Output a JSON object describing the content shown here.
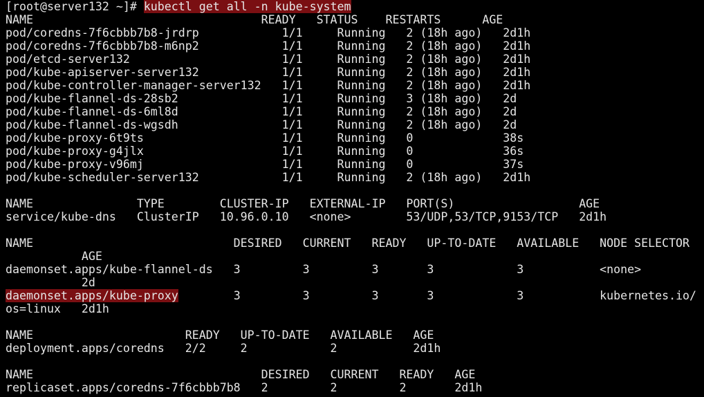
{
  "terminal": {
    "prompt": "[root@server132 ~]# ",
    "command": "kubectl get all -n kube-system",
    "highlight_color": "#7a0f12",
    "background_color": "#000000",
    "text_color": "#e6e6e6",
    "pods": {
      "header": "NAME                                 READY   STATUS    RESTARTS      AGE",
      "rows": [
        "pod/coredns-7f6cbbb7b8-jrdrp            1/1     Running   2 (18h ago)   2d1h",
        "pod/coredns-7f6cbbb7b8-m6np2            1/1     Running   2 (18h ago)   2d1h",
        "pod/etcd-server132                      1/1     Running   2 (18h ago)   2d1h",
        "pod/kube-apiserver-server132            1/1     Running   2 (18h ago)   2d1h",
        "pod/kube-controller-manager-server132   1/1     Running   2 (18h ago)   2d1h",
        "pod/kube-flannel-ds-28sb2               1/1     Running   3 (18h ago)   2d",
        "pod/kube-flannel-ds-6ml8d               1/1     Running   2 (18h ago)   2d",
        "pod/kube-flannel-ds-wgsdh               1/1     Running   2 (18h ago)   2d",
        "pod/kube-proxy-6t9ts                    1/1     Running   0             38s",
        "pod/kube-proxy-g4jlx                    1/1     Running   0             36s",
        "pod/kube-proxy-v96mj                    1/1     Running   0             37s",
        "pod/kube-scheduler-server132            1/1     Running   2 (18h ago)   2d1h"
      ]
    },
    "services": {
      "header": "NAME               TYPE        CLUSTER-IP   EXTERNAL-IP   PORT(S)                  AGE",
      "rows": [
        "service/kube-dns   ClusterIP   10.96.0.10   <none>        53/UDP,53/TCP,9153/TCP   2d1h"
      ]
    },
    "daemonsets": {
      "header": "NAME                             DESIRED   CURRENT   READY   UP-TO-DATE   AVAILABLE   NODE SELECTOR",
      "header_wrap": "           AGE",
      "row1": "daemonset.apps/kube-flannel-ds   3         3         3       3            3           <none>",
      "row1_wrap": "           2d",
      "row2_name": "daemonset.apps/kube-proxy",
      "row2_rest": "        3         3         3       3            3           kubernetes.io/",
      "row2_wrap": "os=linux   2d1h"
    },
    "deployments": {
      "header": "NAME                      READY   UP-TO-DATE   AVAILABLE   AGE",
      "rows": [
        "deployment.apps/coredns   2/2     2            2           2d1h"
      ]
    },
    "replicasets": {
      "header": "NAME                                 DESIRED   CURRENT   READY   AGE",
      "rows": [
        "replicaset.apps/coredns-7f6cbbb7b8   2         2         2       2d1h"
      ]
    }
  }
}
